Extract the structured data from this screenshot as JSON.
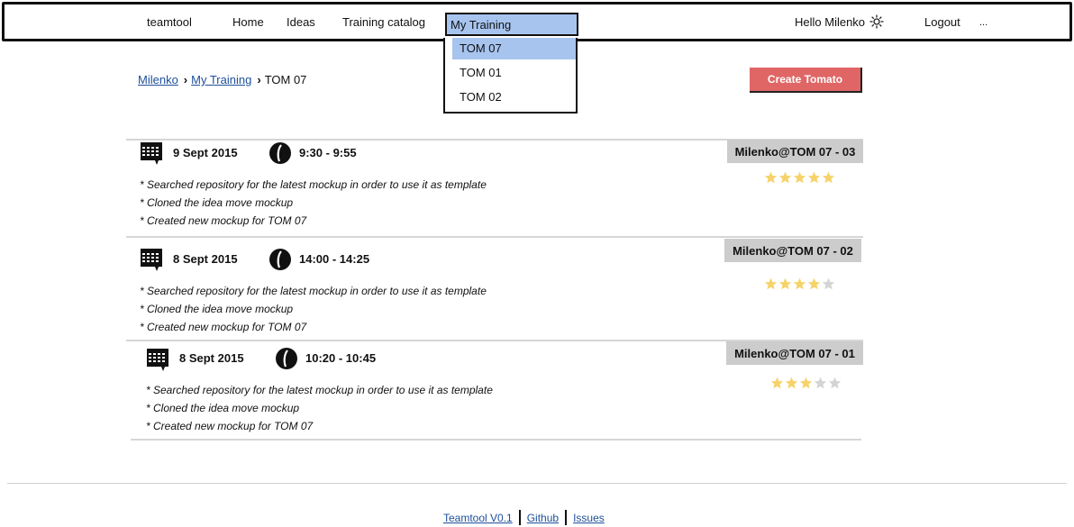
{
  "nav": {
    "brand": "teamtool",
    "home": "Home",
    "ideas": "Ideas",
    "training_catalog": "Training catalog",
    "my_training": "My Training",
    "hello": "Hello Milenko",
    "logout": "Logout",
    "more": "..."
  },
  "dropdown": {
    "items": [
      "TOM 07",
      "TOM 01",
      "TOM 02"
    ],
    "active": "TOM 07"
  },
  "breadcrumb": {
    "user": "Milenko",
    "section": "My Training",
    "current": "TOM 07"
  },
  "create_button": "Create Tomato",
  "sessions": [
    {
      "date": "9 Sept 2015",
      "time": "9:30 - 9:55",
      "tag": "Milenko@TOM 07 - 03",
      "rating": 5,
      "max_rating": 5,
      "notes": [
        "* Searched repository for the latest mockup in order to use it as template",
        "* Cloned the idea move mockup",
        "* Created new mockup for TOM 07"
      ]
    },
    {
      "date": "8 Sept 2015",
      "time": "14:00 - 14:25",
      "tag": "Milenko@TOM 07 - 02",
      "rating": 4,
      "max_rating": 5,
      "notes": [
        "* Searched repository for the latest mockup in order to use it as template",
        "* Cloned the idea move mockup",
        "* Created new mockup for TOM 07"
      ]
    },
    {
      "date": "8 Sept 2015",
      "time": "10:20 - 10:45",
      "tag": "Milenko@TOM 07 - 01",
      "rating": 3,
      "max_rating": 5,
      "notes": [
        "* Searched repository for the latest mockup in order to use it as template",
        "* Cloned the idea move mockup",
        "* Created new mockup for TOM 07"
      ]
    }
  ],
  "footer": {
    "version": "Teamtool V0.1",
    "github": "Github",
    "issues": "Issues"
  },
  "colors": {
    "accent": "#a7c4ef",
    "button": "#e06666",
    "tag_bg": "#cccccc",
    "star_on": "#f6d36a",
    "star_off": "#d4d4d4",
    "link": "#1d4f9a"
  }
}
